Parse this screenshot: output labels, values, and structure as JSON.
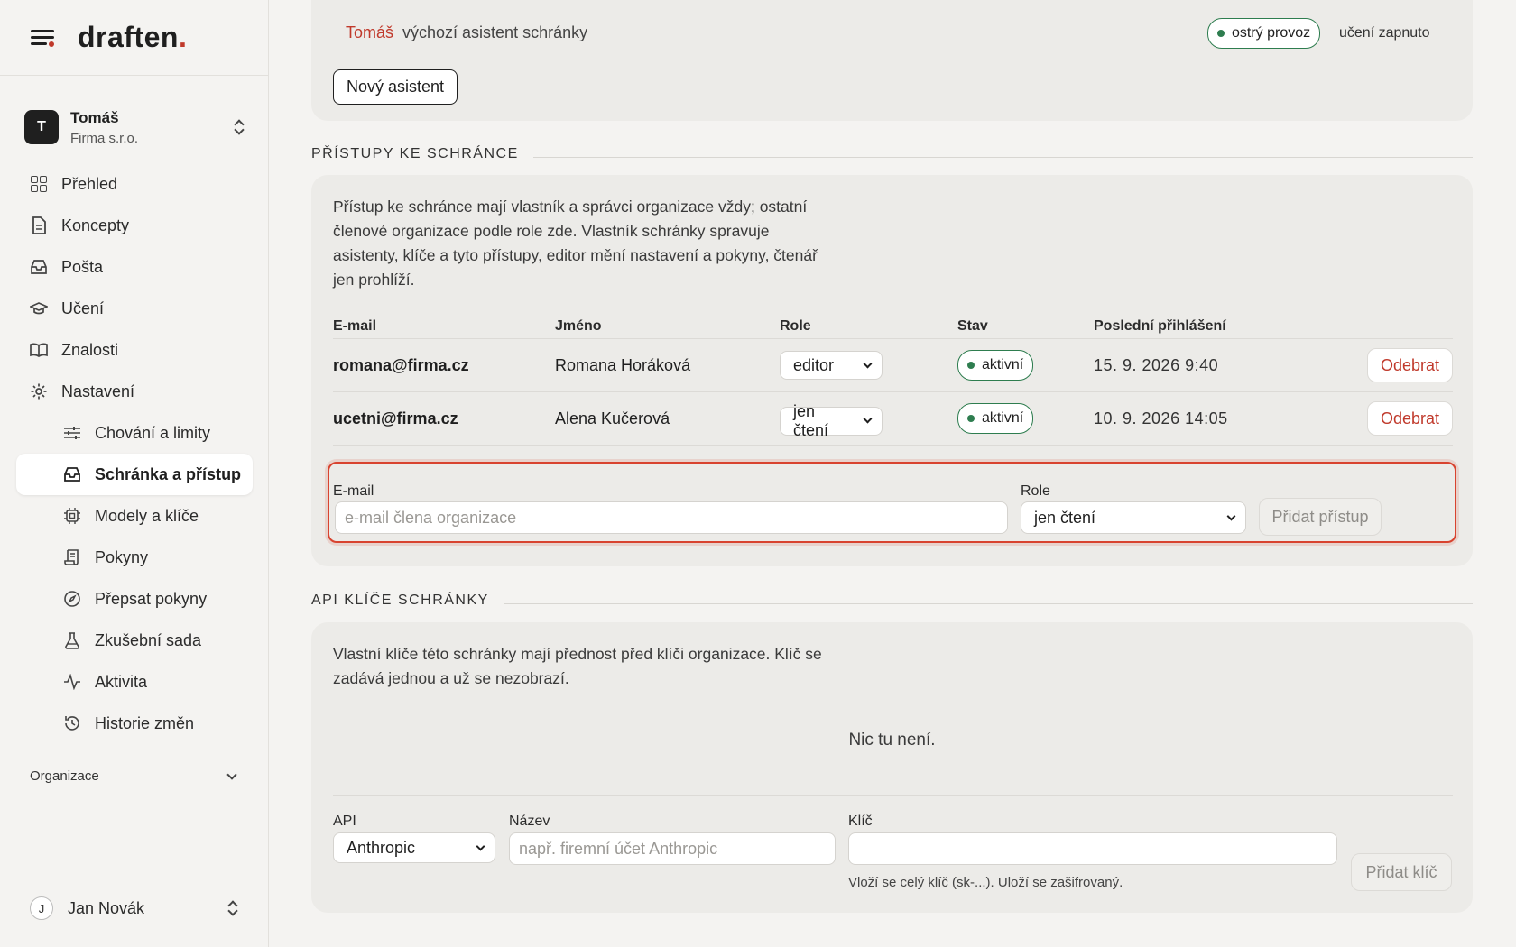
{
  "brand": {
    "name": "draften",
    "dot": "."
  },
  "org_switcher": {
    "initial": "T",
    "name": "Tomáš",
    "company": "Firma s.r.o."
  },
  "nav": [
    {
      "label": "Přehled",
      "icon": "dashboard-icon"
    },
    {
      "label": "Koncepty",
      "icon": "document-icon"
    },
    {
      "label": "Pošta",
      "icon": "inbox-icon"
    },
    {
      "label": "Učení",
      "icon": "graduation-cap-icon"
    },
    {
      "label": "Znalosti",
      "icon": "book-icon"
    },
    {
      "label": "Nastavení",
      "icon": "gear-icon"
    }
  ],
  "subnav": [
    {
      "label": "Chování a limity",
      "icon": "sliders-icon"
    },
    {
      "label": "Schránka a přístup",
      "icon": "inbox-icon"
    },
    {
      "label": "Modely a klíče",
      "icon": "chip-icon"
    },
    {
      "label": "Pokyny",
      "icon": "scroll-icon"
    },
    {
      "label": "Přepsat pokyny",
      "icon": "compass-icon"
    },
    {
      "label": "Zkušební sada",
      "icon": "flask-icon"
    },
    {
      "label": "Aktivita",
      "icon": "activity-icon"
    },
    {
      "label": "Historie změn",
      "icon": "history-icon"
    }
  ],
  "org_section": "Organizace",
  "user": {
    "initial": "J",
    "name": "Jan Novák"
  },
  "assistant": {
    "name": "Tomáš",
    "description": "výchozí asistent schránky",
    "status": "ostrý provoz",
    "learning": "učení zapnuto",
    "new_button": "Nový asistent"
  },
  "access": {
    "title": "PŘÍSTUPY KE SCHRÁNCE",
    "desc1": "Přístup ke schránce mají vlastník a správci organizace vždy; ostatní",
    "desc2": "členové organizace podle role zde. Vlastník schránky spravuje",
    "desc3": "asistenty, klíče a tyto přístupy, editor mění nastavení a pokyny, čtenář",
    "desc4": "jen prohlíží.",
    "columns": [
      "E-mail",
      "Jméno",
      "Role",
      "Stav",
      "Poslední přihlášení"
    ],
    "rows": [
      {
        "email": "romana@firma.cz",
        "name": "Romana Horáková",
        "role": "editor",
        "status": "aktivní",
        "last_login": "15. 9. 2026 9:40",
        "action": "Odebrat"
      },
      {
        "email": "ucetni@firma.cz",
        "name": "Alena Kučerová",
        "role": "jen čtení",
        "status": "aktivní",
        "last_login": "10. 9. 2026 14:05",
        "action": "Odebrat"
      }
    ],
    "form": {
      "email_label": "E-mail",
      "email_placeholder": "e-mail člena organizace",
      "role_label": "Role",
      "role_value": "jen čtení",
      "submit": "Přidat přístup"
    }
  },
  "api": {
    "title": "API KLÍČE SCHRÁNKY",
    "desc1": "Vlastní klíče této schránky mají přednost před klíči organizace. Klíč se",
    "desc2": "zadává jednou a už se nezobrazí.",
    "empty": "Nic tu není.",
    "form": {
      "api_label": "API",
      "api_value": "Anthropic",
      "name_label": "Název",
      "name_placeholder": "např. firemní účet Anthropic",
      "key_label": "Klíč",
      "key_value": "",
      "key_hint": "Vloží se celý klíč (sk-...). Uloží se zašifrovaný.",
      "submit": "Přidat klíč"
    }
  },
  "colors": {
    "accent": "#c0392b",
    "success": "#2e7d4f",
    "highlight": "#d8432f"
  }
}
